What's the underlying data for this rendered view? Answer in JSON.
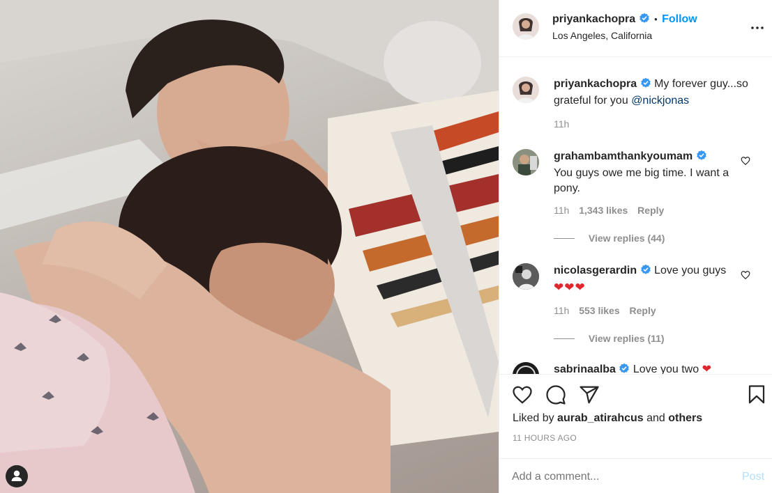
{
  "post": {
    "author": "priyankachopra",
    "location": "Los Angeles, California",
    "follow_label": "Follow",
    "dot": "•",
    "caption_text": "My forever guy...so grateful for you",
    "caption_mention": "@nickjonas",
    "caption_time": "11h"
  },
  "comments": [
    {
      "user": "grahambamthankyoumam",
      "text": "You guys owe me big time. I want a pony.",
      "time": "11h",
      "likes": "1,343 likes",
      "reply": "Reply",
      "view_replies": "View replies (44)"
    },
    {
      "user": "nicolasgerardin",
      "text": "Love you guys",
      "emoji": "❤❤❤",
      "time": "11h",
      "likes": "553 likes",
      "reply": "Reply",
      "view_replies": "View replies (11)"
    },
    {
      "user": "sabrinaalba",
      "text": "Love you two",
      "emoji": "❤"
    }
  ],
  "actions": {
    "liked_by_prefix": "Liked by",
    "liked_by_user": "aurab_atirahcus",
    "liked_by_and": "and",
    "liked_by_others": "others",
    "timestamp": "11 HOURS AGO"
  },
  "add_comment": {
    "placeholder": "Add a comment...",
    "post_label": "Post"
  },
  "colors": {
    "accent": "#0095f6",
    "heart": "#ed4956",
    "muted": "#8e8e8e",
    "post_disabled": "#b2dffc"
  },
  "icons": [
    "user-tag-icon",
    "verified-badge-icon",
    "more-options-icon",
    "heart-outline-icon",
    "comment-icon",
    "share-icon",
    "bookmark-icon"
  ]
}
